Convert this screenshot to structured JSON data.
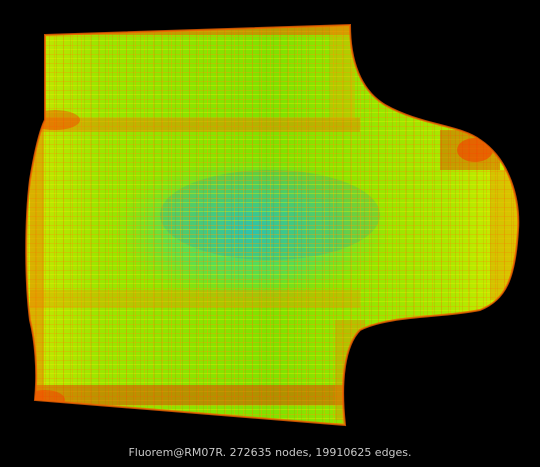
{
  "caption": "Fluorem@RM07R. 272635 nodes, 19910625 edges.",
  "colors": {
    "background": "#000000",
    "mesh_green": "#4be000",
    "mesh_yellow": "#d8f000",
    "mesh_orange": "#f07a00",
    "mesh_red": "#e02a00",
    "mesh_cyan": "#20d0c8",
    "mesh_blue": "#1a7fd0",
    "caption_text": "#c8c8c8"
  }
}
